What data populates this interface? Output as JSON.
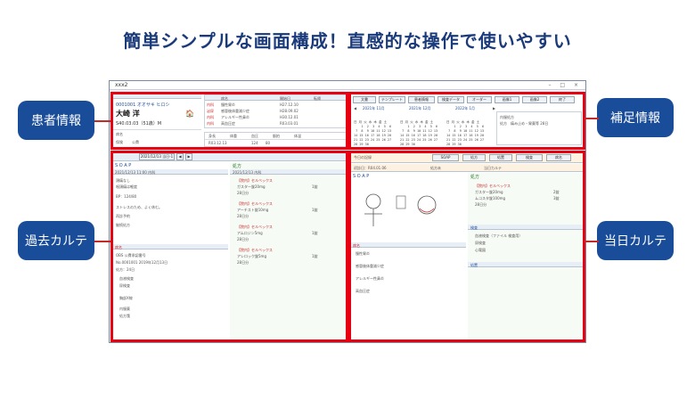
{
  "headline": "簡単シンプルな画面構成！直感的な操作で使いやすい",
  "labels": {
    "patient_info": "患者情報",
    "past_chart": "過去カルテ",
    "supplementary_info": "補足情報",
    "today_chart": "当日カルテ"
  },
  "window": {
    "title": "xxx2"
  },
  "patient": {
    "id_line": "0001001 オオサキ ヒロシ",
    "name": "大崎 洋",
    "birth_line": "S40.03.03（51歳）M",
    "allergy_label": "病名",
    "insurance_label": "保険",
    "insurance_value": "公費",
    "tags": [
      "内科",
      "泌尿"
    ],
    "disease_header": [
      "病名",
      "開始日",
      "転帰"
    ],
    "diseases": [
      "慢性胃炎",
      "感冒後体重減少症",
      "アレルギー性鼻炎",
      "高血圧症"
    ],
    "disease_dates": [
      "H27.12.10",
      "H28.09.02",
      "H30.12.01",
      "R03.03.01"
    ],
    "vitals_header": [
      "身長",
      "体重",
      "血圧",
      "脈拍",
      "体温"
    ],
    "vitals_values": [
      "R03.12.13",
      "124",
      "80"
    ]
  },
  "past": {
    "toolbar_select": "2021/12/13 当日-1",
    "soap_title": "S O A P",
    "record_header": "2021/12/13 11:00 内科",
    "s_lines": [
      "頭痛なし",
      "咽頭痛は軽度",
      "BP：124/80",
      "ストレスのため、よく休む。",
      "再診予約",
      "継続処方"
    ],
    "rx_title": "処方",
    "rx_header": "2021/12/13 内科",
    "rx_items": [
      "【院内】セルベックス",
      "ガスター錠20mg",
      "アーチスト錠10mg",
      "アムロジン5mg",
      "アレロック錠5mg"
    ],
    "rx_amounts": [
      "1錠",
      "1錠",
      "1錠",
      "1錠",
      "1錠"
    ],
    "rx_days": [
      "28日分",
      "28日分",
      "28日分",
      "28日分",
      "28日分"
    ],
    "lower_title": "病名",
    "lower_lines": [
      "OBS 公費承認番号",
      "No.0001001 2019年12月13日",
      "処方：24日"
    ],
    "lower_items": [
      "血液検査",
      "尿検査",
      "胸部X線"
    ],
    "bottom_items": [
      "内服薬",
      "処方箋"
    ]
  },
  "supp": {
    "buttons": [
      "文書",
      "テンプレート",
      "患者情報",
      "検査データ",
      "オーダー",
      "画像1",
      "画像2",
      "終了"
    ],
    "months": [
      "2021年 11月",
      "2021年 12月",
      "2022年 1月"
    ],
    "calendar_rows": [
      "日 月 火 水 木 金 土",
      "    1  2  3  4  5  6",
      " 7  8  9 10 11 12 13",
      "14 15 16 17 18 19 20",
      "21 22 23 24 25 26 27",
      "28 29 30"
    ],
    "note_line1": "内服処方",
    "note_line2": "処方　痛み止め・胃薬等 28日"
  },
  "today": {
    "header_left": "初診日：R04.01.06",
    "header_mid": "処方未",
    "header_right": "当日カルテ",
    "record_label": "今日の記録",
    "soap_title": "S O A P",
    "rx_title": "処方",
    "rx_items": [
      "【院内】セルベックス",
      "ガスター錠20mg",
      "ムコスタ錠100mg"
    ],
    "rx_amounts": [
      "3錠",
      "2錠",
      "3錠"
    ],
    "rx_days": [
      "28日分",
      "28日分",
      "28日分"
    ],
    "diag_title": "病名",
    "diag_items": [
      "慢性胃炎",
      "感冒後体重減少症",
      "アレルギー性鼻炎",
      "高血圧症"
    ],
    "exam_title": "検査",
    "exam_items": [
      "血液検査（ファイル 検査用）",
      "尿検査",
      "心電図"
    ],
    "bottom_title": "処置",
    "tabs": [
      "SOAP",
      "処方",
      "処置",
      "検査",
      "病名"
    ]
  }
}
